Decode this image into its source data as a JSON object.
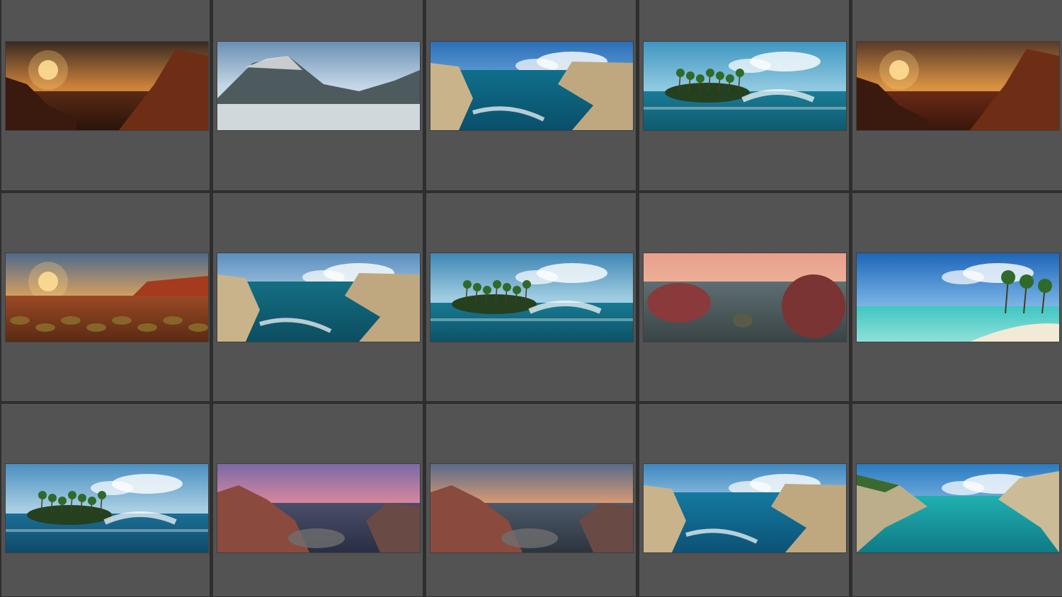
{
  "app": {
    "view": "thumbnail-grid",
    "columns": 5,
    "rows": 3,
    "background": "#2e2e2e",
    "cell_color": "#535353"
  },
  "thumbnails": [
    {
      "scene": "canyon-sunset",
      "sky": [
        "#3a2a22",
        "#c9803a",
        "#f4b25a"
      ],
      "ground": [
        "#5a2a14",
        "#2a140a"
      ],
      "sun": true,
      "kind": "canyon"
    },
    {
      "scene": "mountain-fog",
      "sky": [
        "#6a8fb3",
        "#c3d6e6",
        "#e6edf2"
      ],
      "ground": [
        "#3a4a50",
        "#1f2e2f"
      ],
      "sun": false,
      "kind": "mountain"
    },
    {
      "scene": "sea-cliffs",
      "sky": [
        "#2d6fb8",
        "#6aa8dc",
        "#9ec9ea"
      ],
      "ground": [
        "#0f6f8c",
        "#0a4f6a"
      ],
      "sun": false,
      "kind": "cliffs"
    },
    {
      "scene": "palm-island-wave",
      "sky": [
        "#3f96c2",
        "#8cc7df",
        "#c7e6f0"
      ],
      "ground": [
        "#1a7c96",
        "#0f5a70"
      ],
      "sun": false,
      "kind": "island"
    },
    {
      "scene": "canyon-sunburst",
      "sky": [
        "#5a3a2a",
        "#d59040",
        "#f2c074"
      ],
      "ground": [
        "#6a2a16",
        "#3a160c"
      ],
      "sun": true,
      "kind": "canyon"
    },
    {
      "scene": "desert-sunset",
      "sky": [
        "#4f6a8a",
        "#d8a060",
        "#f3c27a"
      ],
      "ground": [
        "#9a4a24",
        "#5a2a14"
      ],
      "sun": true,
      "kind": "desert"
    },
    {
      "scene": "cliff-coast",
      "sky": [
        "#5b8fbf",
        "#a9c9e2",
        "#dbe9f2"
      ],
      "ground": [
        "#146f84",
        "#0c4d60"
      ],
      "sun": false,
      "kind": "cliffs"
    },
    {
      "scene": "island-horizon",
      "sky": [
        "#3f86b5",
        "#9ecbe0",
        "#d9edf4"
      ],
      "ground": [
        "#177a92",
        "#0d5268"
      ],
      "sun": false,
      "kind": "island"
    },
    {
      "scene": "red-boulders-lake",
      "sky": [
        "#e7a08c",
        "#f0b79a",
        "#d9a08e"
      ],
      "ground": [
        "#5e6e72",
        "#3a4446"
      ],
      "sun": false,
      "kind": "boulders"
    },
    {
      "scene": "tropical-beach",
      "sky": [
        "#1f66b8",
        "#6aa8e0",
        "#cfe6f5"
      ],
      "ground": [
        "#3fc6c2",
        "#8fe0d8"
      ],
      "sun": false,
      "kind": "beach"
    },
    {
      "scene": "palm-shore-waves",
      "sky": [
        "#4a8fc0",
        "#a6cde3",
        "#dcecf4"
      ],
      "ground": [
        "#1b6f96",
        "#0f4a6a"
      ],
      "sun": false,
      "kind": "island"
    },
    {
      "scene": "pink-sunset-rocks",
      "sky": [
        "#7a6aa8",
        "#e48a9a",
        "#f4b08a"
      ],
      "ground": [
        "#4a4e6a",
        "#2a2e44"
      ],
      "sun": false,
      "kind": "rocks"
    },
    {
      "scene": "rocky-shore-dusk",
      "sky": [
        "#5a6a8a",
        "#e8a070",
        "#f6c78a"
      ],
      "ground": [
        "#4e5a6a",
        "#2c343e"
      ],
      "sun": false,
      "kind": "rocks"
    },
    {
      "scene": "arch-cliff-sea",
      "sky": [
        "#3f86c0",
        "#9fcbe6",
        "#e0eef6"
      ],
      "ground": [
        "#147aa0",
        "#0c5276"
      ],
      "sun": false,
      "kind": "cliffs"
    },
    {
      "scene": "turquoise-cove",
      "sky": [
        "#2a7ac0",
        "#7fb8e3",
        "#c9e2f2"
      ],
      "ground": [
        "#1fb0b0",
        "#0f7a86"
      ],
      "sun": false,
      "kind": "cove"
    }
  ]
}
